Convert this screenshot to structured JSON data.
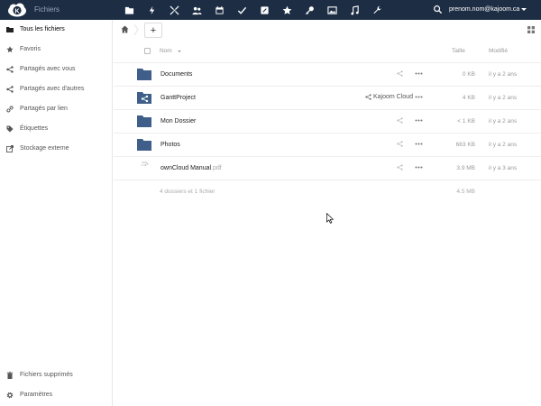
{
  "header": {
    "app_title": "Fichiers",
    "user": "prenom.nom@kajoom.ca",
    "apps": [
      "folder-icon",
      "activity-icon",
      "gallery-cross-icon",
      "contacts-icon",
      "calendar-icon",
      "tasks-check-icon",
      "notes-icon",
      "favorite-star-icon",
      "key-icon",
      "image-icon",
      "music-icon",
      "wrench-icon"
    ]
  },
  "sidebar": {
    "items": [
      {
        "label": "Tous les fichiers",
        "icon": "folder-icon"
      },
      {
        "label": "Favoris",
        "icon": "star-icon"
      },
      {
        "label": "Partagés avec vous",
        "icon": "share-icon"
      },
      {
        "label": "Partagés avec d'autres",
        "icon": "share-icon"
      },
      {
        "label": "Partagés par lien",
        "icon": "link-icon"
      },
      {
        "label": "Étiquettes",
        "icon": "tag-icon"
      },
      {
        "label": "Stockage externe",
        "icon": "external-icon"
      }
    ],
    "bottom": [
      {
        "label": "Fichiers supprimés",
        "icon": "trash-icon"
      },
      {
        "label": "Paramètres",
        "icon": "gear-icon"
      }
    ]
  },
  "controls": {
    "add_label": "+"
  },
  "table": {
    "col_name": "Nom",
    "col_size": "Taille",
    "col_modified": "Modifié",
    "rows": [
      {
        "name": "Documents",
        "ext": "",
        "type": "folder",
        "size": "0 KB",
        "modified": "il y a 2 ans",
        "share": ""
      },
      {
        "name": "GanttProject",
        "ext": "",
        "type": "shared-folder",
        "size": "4 KB",
        "modified": "il y a 2 ans",
        "share": "Kajoom Cloud"
      },
      {
        "name": "Mon Dossier",
        "ext": "",
        "type": "folder",
        "size": "< 1 KB",
        "modified": "il y a 2 ans",
        "share": ""
      },
      {
        "name": "Photos",
        "ext": "",
        "type": "folder",
        "size": "663 KB",
        "modified": "il y a 2 ans",
        "share": ""
      },
      {
        "name": "ownCloud Manual",
        "ext": ".pdf",
        "type": "file",
        "size": "3.9 MB",
        "modified": "il y a 3 ans",
        "share": ""
      }
    ],
    "summary_text": "4 dossiers et 1 fichier",
    "summary_size": "4.5 MB"
  },
  "colors": {
    "header_bg": "#1d2d44",
    "folder": "#3f5f8a"
  }
}
